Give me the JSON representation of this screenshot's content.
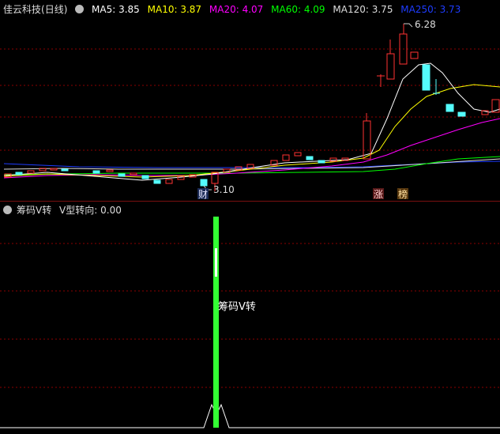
{
  "main": {
    "title": "佳云科技",
    "period": "(日线)",
    "indicators": [
      {
        "label": "MA5: 3.85",
        "color": "#ffffff"
      },
      {
        "label": "MA10: 3.87",
        "color": "#ffff00"
      },
      {
        "label": "MA20: 4.07",
        "color": "#ff00ff"
      },
      {
        "label": "MA60: 4.09",
        "color": "#00ff00"
      },
      {
        "label": "MA120: 3.75",
        "color": "#dddddd"
      },
      {
        "label": "MA250: 3.73",
        "color": "#1e3cff"
      }
    ],
    "high_label": "6.28",
    "low_label": "3.10",
    "badges": {
      "cai": "财",
      "zhang": "涨",
      "bang": "榜"
    }
  },
  "sub": {
    "title": "筹码V转",
    "value_label": "V型转向: 0.00",
    "annotation": "筹码V转"
  },
  "colors": {
    "up": "#ff3232",
    "down": "#54fcfc",
    "grid": "#8b0000",
    "bar": "#33ff33"
  }
}
